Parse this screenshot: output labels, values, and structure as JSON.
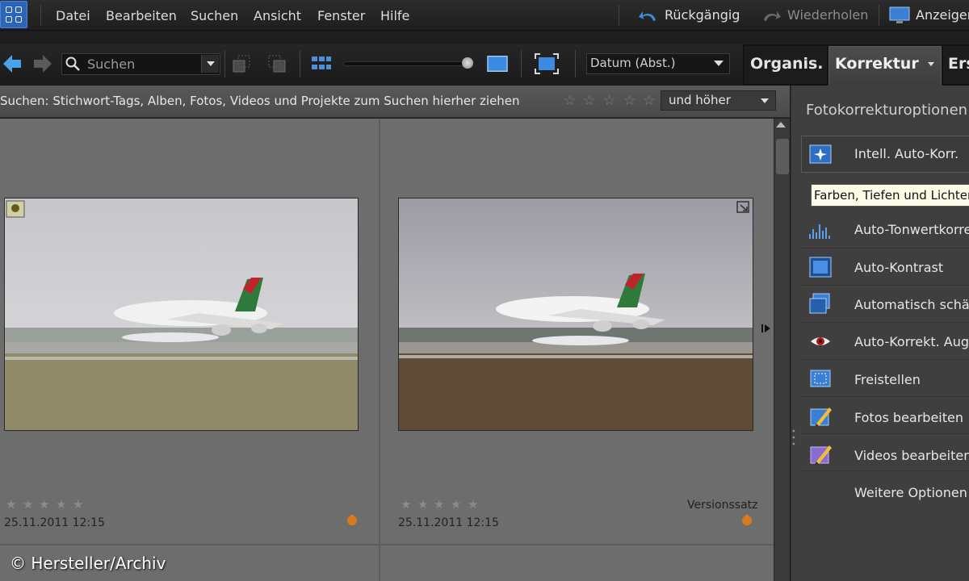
{
  "menu": {
    "items": [
      "Datei",
      "Bearbeiten",
      "Suchen",
      "Ansicht",
      "Fenster",
      "Hilfe"
    ],
    "undo_label": "Rückgängig",
    "redo_label": "Wiederholen",
    "display_label": "Anzeigen"
  },
  "toolbar": {
    "search_placeholder": "Suchen",
    "sort_value": "Datum (Abst.)"
  },
  "tabs": {
    "organize": "Organis.",
    "fix": "Korrektur",
    "create": "Ers"
  },
  "searchbar": {
    "hint": "Suchen: Stichwort-Tags, Alben, Fotos, Videos und Projekte zum Suchen hierher ziehen",
    "rating_filter": "und höher"
  },
  "grid": {
    "items": [
      {
        "date": "25.11.2011 12:15",
        "rating": 0,
        "version_label": ""
      },
      {
        "date": "25.11.2011 12:15",
        "rating": 0,
        "version_label": "Versionssatz"
      }
    ]
  },
  "panel": {
    "title": "Fotokorrekturoptionen",
    "tooltip": "Farben, Tiefen und Lichter",
    "options": [
      {
        "label": "Intell. Auto-Korr.",
        "icon": "smart-fix-icon"
      },
      {
        "label": "Auto-Tonwertkorrektur",
        "icon": "levels-icon"
      },
      {
        "label": "Auto-Kontrast",
        "icon": "contrast-icon"
      },
      {
        "label": "Automatisch schärfen",
        "icon": "sharpen-icon"
      },
      {
        "label": "Auto-Korrekt. Augen",
        "icon": "red-eye-icon"
      },
      {
        "label": "Freistellen",
        "icon": "crop-icon"
      },
      {
        "label": "Fotos bearbeiten",
        "icon": "edit-photo-icon"
      },
      {
        "label": "Videos bearbeiten",
        "icon": "edit-video-icon"
      },
      {
        "label": "Weitere Optionen",
        "icon": ""
      }
    ]
  },
  "watermark": "© Hersteller/Archiv"
}
